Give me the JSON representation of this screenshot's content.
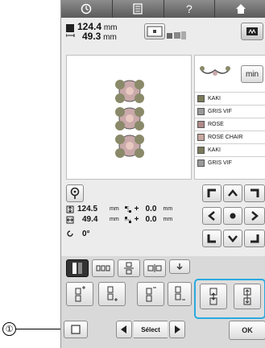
{
  "header": {
    "tabs": [
      {
        "icon": "clock-icon"
      },
      {
        "icon": "document-icon"
      },
      {
        "icon": "help-icon",
        "label": "?"
      },
      {
        "icon": "home-icon"
      }
    ]
  },
  "size": {
    "width_value": "124.4",
    "height_value": "49.3",
    "unit": "mm"
  },
  "min_label": "min",
  "threads": [
    {
      "name": "KAKI",
      "color": "#7a7a5a"
    },
    {
      "name": "GRIS VIF",
      "color": "#9a9a9a"
    },
    {
      "name": "ROSE",
      "color": "#b08a8a"
    },
    {
      "name": "ROSE CHAIR",
      "color": "#c8a8a0"
    },
    {
      "name": "KAKI",
      "color": "#7a7a5a"
    },
    {
      "name": "GRIS VIF",
      "color": "#9a9a9a"
    }
  ],
  "layout": {
    "height_value": "124.5",
    "width_value": "49.4",
    "unit": "mm",
    "offset_v": "0.0",
    "offset_h": "0.0",
    "offset_prefix": "+",
    "angle": "0°"
  },
  "bottom": {
    "select_label": "Sélect",
    "ok_label": "OK"
  },
  "callout": {
    "number": "①"
  }
}
